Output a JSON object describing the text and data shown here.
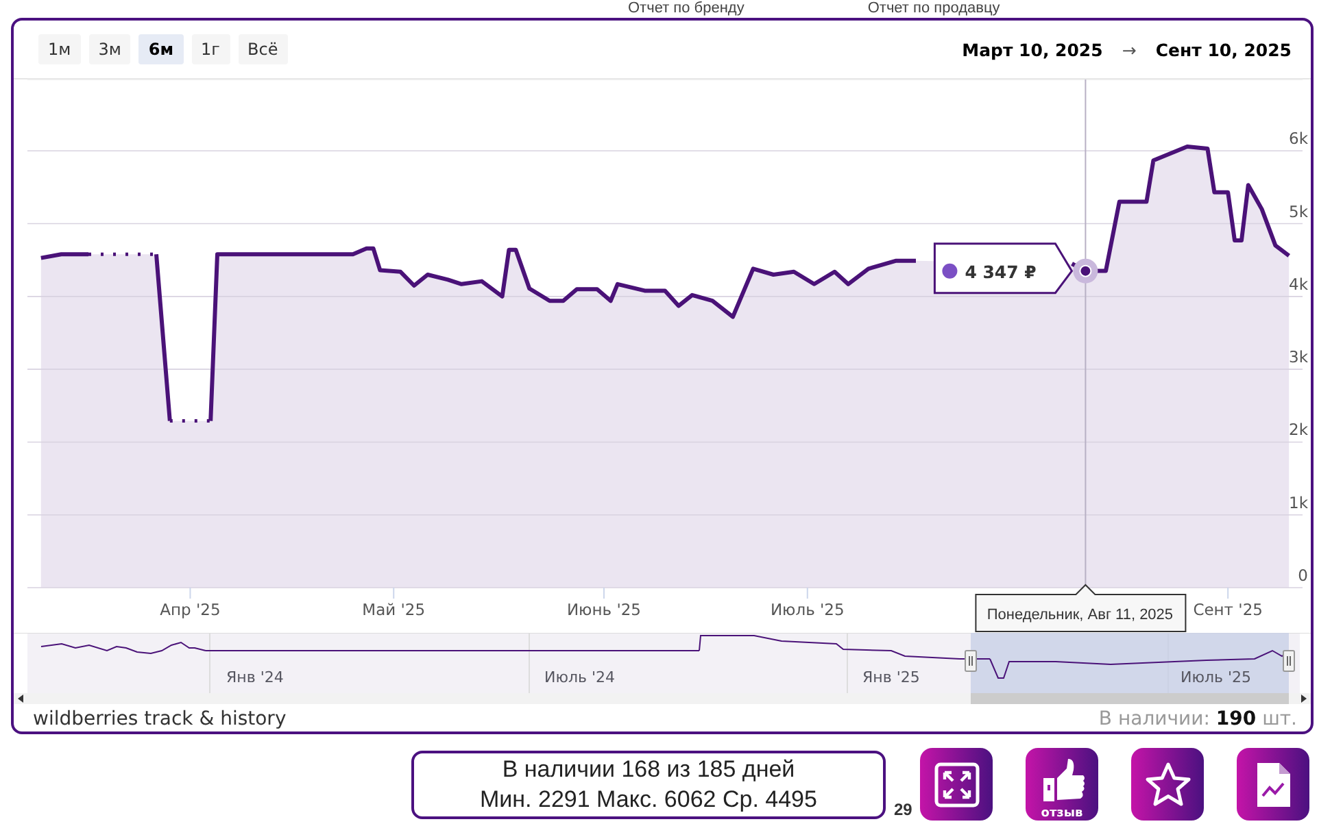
{
  "top_links": [
    "Отчет по бренду",
    "Отчет по продавцу"
  ],
  "range_buttons": [
    {
      "label": "1м",
      "selected": false
    },
    {
      "label": "3м",
      "selected": false
    },
    {
      "label": "6м",
      "selected": true
    },
    {
      "label": "1г",
      "selected": false
    },
    {
      "label": "Всё",
      "selected": false
    }
  ],
  "date_range": {
    "from": "Март 10, 2025",
    "separator": "→",
    "to": "Сент 10, 2025"
  },
  "chart_data": {
    "type": "area",
    "grid": true,
    "xlim": [
      "2025-03-08",
      "2025-09-12"
    ],
    "ylim": [
      0,
      7000
    ],
    "xticks": [
      {
        "value": "2025-04-01",
        "label": "Апр '25"
      },
      {
        "value": "2025-05-01",
        "label": "Май '25"
      },
      {
        "value": "2025-06-01",
        "label": "Июнь '25"
      },
      {
        "value": "2025-07-01",
        "label": "Июль '25"
      },
      {
        "value": "2025-09-01",
        "label": "Сент '25"
      }
    ],
    "yticks": [
      0,
      {
        "value": 1000,
        "label": "1k"
      },
      {
        "value": 2000,
        "label": "2k"
      },
      {
        "value": 3000,
        "label": "3k"
      },
      {
        "value": 4000,
        "label": "4k"
      },
      {
        "value": 5000,
        "label": "5k"
      },
      {
        "value": 6000,
        "label": "6k"
      }
    ],
    "x": [
      "2025-03-10",
      "2025-03-13",
      "2025-03-17",
      "2025-03-22",
      "2025-03-27",
      "2025-03-29",
      "2025-04-02",
      "2025-04-04",
      "2025-04-05",
      "2025-04-25",
      "2025-04-27",
      "2025-04-28",
      "2025-04-29",
      "2025-05-02",
      "2025-05-04",
      "2025-05-06",
      "2025-05-09",
      "2025-05-11",
      "2025-05-14",
      "2025-05-17",
      "2025-05-18",
      "2025-05-19",
      "2025-05-21",
      "2025-05-24",
      "2025-05-26",
      "2025-05-28",
      "2025-05-31",
      "2025-06-02",
      "2025-06-03",
      "2025-06-07",
      "2025-06-10",
      "2025-06-12",
      "2025-06-14",
      "2025-06-17",
      "2025-06-20",
      "2025-06-23",
      "2025-06-26",
      "2025-06-29",
      "2025-07-02",
      "2025-07-05",
      "2025-07-07",
      "2025-07-10",
      "2025-07-14",
      "2025-07-17",
      "2025-07-22",
      "2025-07-28",
      "2025-08-05",
      "2025-08-09",
      "2025-08-11",
      "2025-08-13",
      "2025-08-14",
      "2025-08-16",
      "2025-08-20",
      "2025-08-21",
      "2025-08-26",
      "2025-08-29",
      "2025-08-30",
      "2025-09-01",
      "2025-09-02",
      "2025-09-03",
      "2025-09-04",
      "2025-09-06",
      "2025-09-08",
      "2025-09-10"
    ],
    "series": [
      {
        "color": "#4a1278",
        "values": [
          4530,
          4580,
          4580,
          null,
          4580,
          2290,
          null,
          2290,
          4580,
          4580,
          4660,
          4660,
          4360,
          4340,
          4150,
          4300,
          4230,
          4170,
          4210,
          4000,
          4640,
          4640,
          4110,
          3940,
          3940,
          4100,
          4100,
          3940,
          4170,
          4080,
          4080,
          3870,
          4020,
          3940,
          3720,
          4380,
          4300,
          4340,
          4170,
          4340,
          4170,
          4380,
          4490,
          4490,
          null,
          null,
          null,
          4450,
          4350,
          4350,
          4350,
          5300,
          5300,
          5870,
          6060,
          6030,
          5430,
          5430,
          4770,
          4770,
          5530,
          5200,
          4700,
          4560
        ]
      }
    ],
    "ref_lines": [
      {
        "axis": "x",
        "value": "2025-08-11"
      }
    ],
    "annotations": [
      {
        "x": "2025-08-11",
        "y": 4350,
        "text": "4 347 ₽"
      }
    ]
  },
  "crosshair_label": "Понедельник, Авг 11, 2025",
  "navigator": {
    "labels": [
      "Янв '24",
      "Июль '24",
      "Янв '25",
      "Июль '25"
    ]
  },
  "footer": {
    "brand": "wildberries track & history",
    "stock": "В наличии: **190** шт."
  },
  "stats": [
    "В наличии 168 из 185 дней",
    "Мин. 2291 Макс. 6062 Ср. 4495"
  ],
  "behind_text": "29",
  "actions": [
    {
      "kind": "expand"
    },
    {
      "kind": "review",
      "label": "отзыв"
    },
    {
      "kind": "star"
    },
    {
      "kind": "report"
    }
  ]
}
